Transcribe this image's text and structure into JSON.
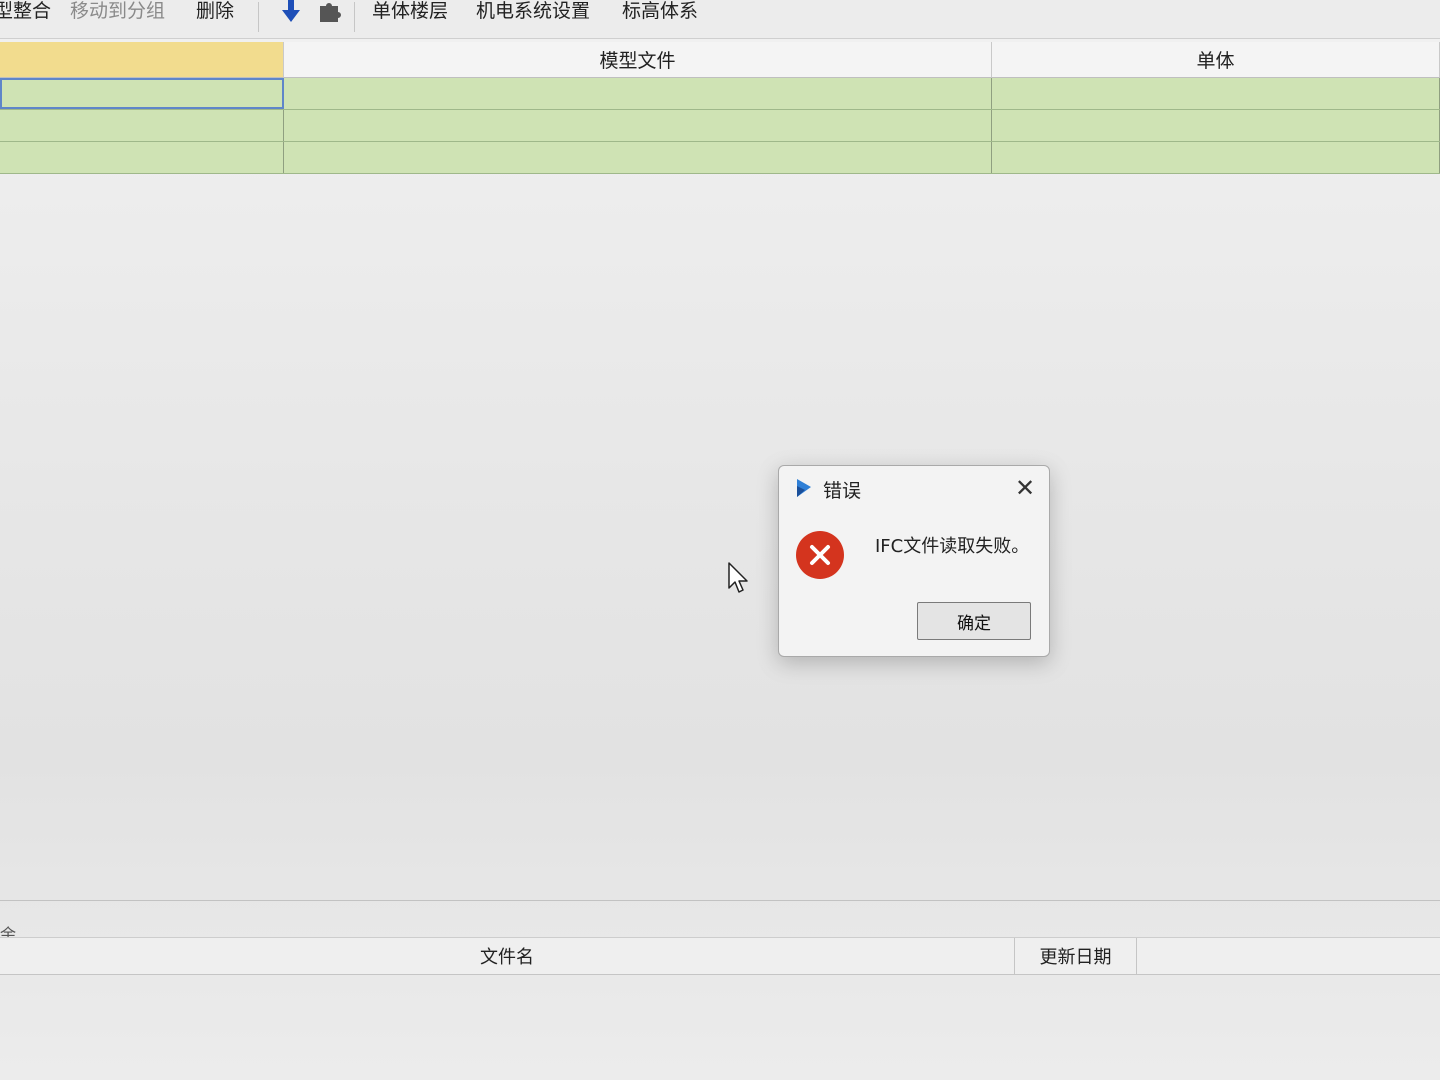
{
  "toolbar": {
    "items": [
      {
        "label": "型整合",
        "enabled": true
      },
      {
        "label": "移动到分组",
        "enabled": false
      },
      {
        "label": "删除",
        "enabled": true
      },
      {
        "label": "单体楼层",
        "enabled": true
      },
      {
        "label": "机电系统设置",
        "enabled": true
      },
      {
        "label": "标高体系",
        "enabled": true
      }
    ],
    "icons": [
      "arrow-down-icon",
      "puzzle-icon"
    ],
    "accent_color": "#1e4fb8"
  },
  "top_grid": {
    "columns": [
      "",
      "模型文件",
      "单体"
    ],
    "row_color": "#cfe3b4",
    "selected_header_color": "#f2dc8e"
  },
  "bottom_panel": {
    "caption": "余",
    "columns": [
      "文件名",
      "更新日期"
    ]
  },
  "dialog": {
    "title": "错误",
    "message": "IFC文件读取失败。",
    "ok_label": "确定",
    "close_glyph": "✕",
    "error_color": "#d4341e"
  }
}
